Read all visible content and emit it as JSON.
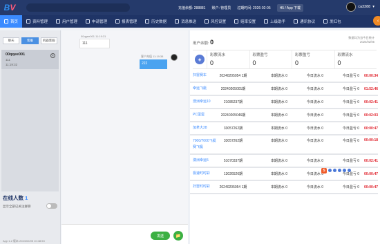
{
  "app": {
    "logo_b": "B",
    "logo_v": "V"
  },
  "topbar": {
    "info1": "充值余额: 288881",
    "info2": "账户: 管理员",
    "info3": "过期时间: 2026-02-05",
    "download": "H5 / App 下载",
    "username": "ca3388"
  },
  "nav": [
    {
      "label": "首页",
      "icon": "home-icon"
    },
    {
      "label": "资料管理",
      "icon": "file-icon"
    },
    {
      "label": "用户管理",
      "icon": "user-icon"
    },
    {
      "label": "申请管理",
      "icon": "list-icon"
    },
    {
      "label": "报表管理",
      "icon": "report-icon"
    },
    {
      "label": "历史数据",
      "icon": "history-icon"
    },
    {
      "label": "消息推送",
      "icon": "message-icon"
    },
    {
      "label": "风控设置",
      "icon": "shield-icon"
    },
    {
      "label": "赔率设置",
      "icon": "odds-icon"
    },
    {
      "label": "上级助手",
      "icon": "assistant-icon"
    },
    {
      "label": "通讯协议",
      "icon": "protocol-icon"
    },
    {
      "label": "发红包",
      "icon": "redpacket-icon"
    }
  ],
  "left": {
    "tabs": [
      "聊天",
      "客服",
      "机器客服"
    ],
    "session": {
      "name": "00qqee001",
      "line1": "111",
      "line2": "11:19:32"
    },
    "online_label": "在线人数",
    "online_count": "1",
    "online_sub": "显示全部已关注群聊",
    "version": "App 1.2 版本 2024/02/05 10:48:53"
  },
  "chat": {
    "left_meta": "00qqee001 11:19:31",
    "left_text": "111",
    "right_meta": "客户充值 11:19:38",
    "right_text": "222",
    "send_label": "发送",
    "attach_icon": "📁"
  },
  "right": {
    "user_balance_label": "用户余额:",
    "user_balance": "0",
    "data_src_line1": "数据均为当今日统计",
    "data_src_line2": "2024/02/05",
    "stat_icon": "stats-icon",
    "stats": [
      {
        "label": "彩票流水",
        "value": "0"
      },
      {
        "label": "彩票盈亏",
        "value": "0"
      },
      {
        "label": "彩票盈亏",
        "value": "0"
      },
      {
        "label": "彩票流水",
        "value": "0"
      }
    ],
    "rows": [
      {
        "name": "扫雷赛车",
        "period": "20240205054 1期",
        "c3": "本期流水 0",
        "c4": "今日流水 0",
        "c5": "今日盈亏 0",
        "time": "00:00:34",
        "tall": false
      },
      {
        "name": "幸运飞艇",
        "period": "20240205001期",
        "c3": "本期流水 0",
        "c4": "今日流水 0",
        "c5": "今日盈亏 0",
        "time": "01:52:46",
        "tall": false
      },
      {
        "name": "澳洲幸运10",
        "period": "21085237期",
        "c3": "本期流水 0",
        "c4": "今日流水 0",
        "c5": "今日盈亏 0",
        "time": "00:02:41",
        "tall": false
      },
      {
        "name": "PC蛋蛋",
        "period": "20240205046期",
        "c3": "本期流水 0",
        "c4": "今日流水 0",
        "c5": "今日盈亏 0",
        "time": "00:02:03",
        "tall": false
      },
      {
        "name": "加拿大28",
        "period": "33057262期",
        "c3": "本期流水 0",
        "c4": "今日流水 0",
        "c5": "今日盈亏 0",
        "time": "00:00:47",
        "tall": false
      },
      {
        "name": "7000/7000飞艇",
        "name2": "赛飞艇",
        "period": "33057262期",
        "c3": "本期流水 0",
        "c4": "今日流水 0",
        "c5": "今日盈亏 0",
        "time": "00:00:18",
        "tall": true
      },
      {
        "name": "澳洲幸运5",
        "period": "51070337期",
        "c3": "本期流水 0",
        "c4": "今日流水 0",
        "c5": "今日盈亏 0",
        "time": "00:02:41",
        "tall": false
      },
      {
        "name": "极速时时彩",
        "period": "13026526期",
        "c3": "本期流水 0",
        "c4": "今日流水 0",
        "c5": "今日盈亏 0",
        "time": "00:00:47",
        "tall": false
      },
      {
        "name": "扫雷时时彩",
        "period": "20240205054 1期",
        "c3": "本期流水 0",
        "c4": "今日流水 0",
        "c5": "今日盈亏 0",
        "time": "00:00:47",
        "tall": false
      }
    ]
  },
  "colors": {
    "topbar": "#253a6b",
    "nav": "#1f3466",
    "accent": "#3b8bff",
    "countdown": "#e0202a",
    "send": "#3cb043"
  }
}
